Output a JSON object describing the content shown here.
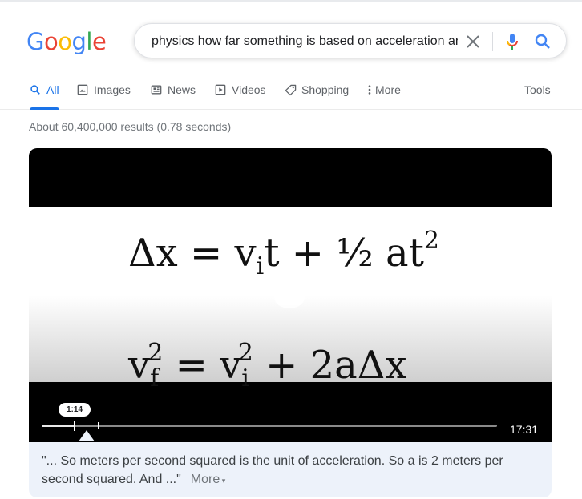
{
  "logo": {
    "letters": [
      "G",
      "o",
      "o",
      "g",
      "l",
      "e"
    ],
    "colors": [
      "#4285F4",
      "#EA4335",
      "#FBBC05",
      "#4285F4",
      "#34A853",
      "#EA4335"
    ]
  },
  "search": {
    "query": "physics how far something is based on acceleration an",
    "clear_icon": "close-icon",
    "mic_icon": "microphone-icon",
    "search_icon": "search-icon"
  },
  "tabs": [
    {
      "label": "All",
      "icon": "search-icon",
      "active": true
    },
    {
      "label": "Images",
      "icon": "image-icon"
    },
    {
      "label": "News",
      "icon": "news-icon"
    },
    {
      "label": "Videos",
      "icon": "video-icon"
    },
    {
      "label": "Shopping",
      "icon": "tag-icon"
    },
    {
      "label": "More",
      "icon": "more-vertical-icon"
    }
  ],
  "tools_label": "Tools",
  "result_stats": "About 60,400,000 results (0.78 seconds)",
  "video": {
    "equation1": {
      "lhs": "Δx = v",
      "sub": "i",
      "mid": "t  +  ½ at",
      "sup": "2"
    },
    "equation2": {
      "v": "v",
      "sub1": "f",
      "sup1": "2",
      "eq": " =  v",
      "sub2": "i",
      "sup2": "2",
      "rest": "  +  2aΔx"
    },
    "current_time": "1:14",
    "duration": "17:31",
    "progress_fraction": 0.071
  },
  "snippet": {
    "text": "\"... So meters per second squared is the unit of acceleration. So a is 2 meters per second squared. And ...\"",
    "more_label": "More"
  },
  "colors": {
    "accent": "#1a73e8",
    "muted": "#70757a",
    "card_bg": "#edf2fa"
  }
}
